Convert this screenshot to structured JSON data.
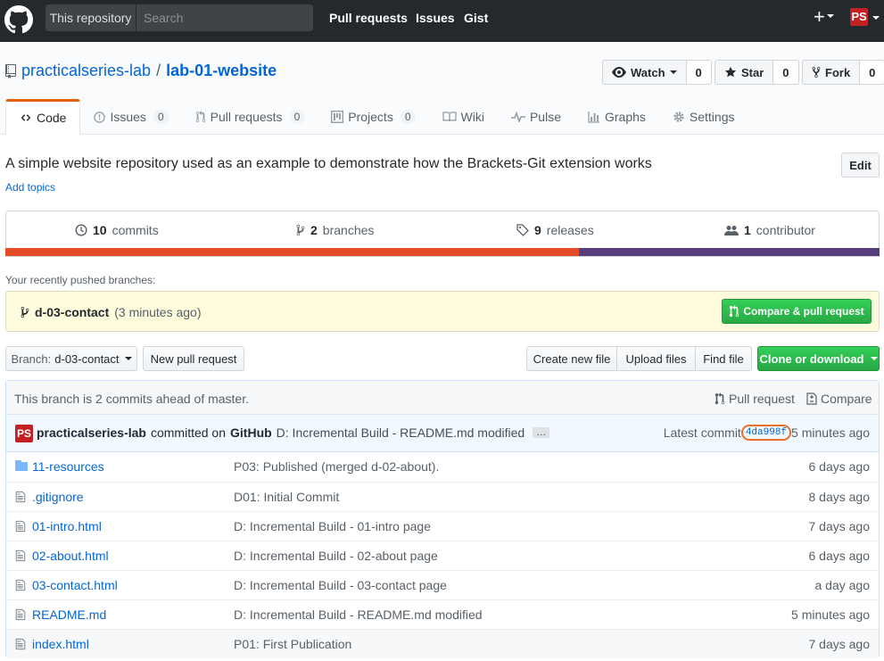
{
  "header": {
    "scope": "This repository",
    "search_placeholder": "Search",
    "nav": [
      "Pull requests",
      "Issues",
      "Gist"
    ],
    "plus": "+",
    "avatar_initials": "PS"
  },
  "repo": {
    "owner": "practicalseries-lab",
    "separator": "/",
    "name": "lab-01-website",
    "watch_label": "Watch",
    "watch_count": "0",
    "star_label": "Star",
    "star_count": "0",
    "fork_label": "Fork",
    "fork_count": "0"
  },
  "tabs": [
    {
      "label": "Code",
      "count": ""
    },
    {
      "label": "Issues",
      "count": "0"
    },
    {
      "label": "Pull requests",
      "count": "0"
    },
    {
      "label": "Projects",
      "count": "0"
    },
    {
      "label": "Wiki",
      "count": ""
    },
    {
      "label": "Pulse",
      "count": ""
    },
    {
      "label": "Graphs",
      "count": ""
    },
    {
      "label": "Settings",
      "count": ""
    }
  ],
  "description": "A simple website repository used as an example to demonstrate how the Brackets-Git extension works",
  "add_topics": "Add topics",
  "edit_label": "Edit",
  "summary": {
    "commits_n": "10",
    "commits_label": "commits",
    "branches_n": "2",
    "branches_label": "branches",
    "releases_n": "9",
    "releases_label": "releases",
    "contrib_n": "1",
    "contrib_label": "contributor"
  },
  "language_colors": [
    "#e34c26",
    "#563d7c"
  ],
  "language_share": [
    0.656,
    0.344
  ],
  "recent": {
    "label": "Your recently pushed branches:",
    "branch": "d-03-contact",
    "time": "(3 minutes ago)",
    "compare_label": "Compare & pull request"
  },
  "filenav": {
    "branch_prefix": "Branch:",
    "branch_name": "d-03-contact",
    "new_pr": "New pull request",
    "create_file": "Create new file",
    "upload": "Upload files",
    "find": "Find file",
    "clone": "Clone or download"
  },
  "ahead": {
    "text": "This branch is 2 commits ahead of master.",
    "pr_label": "Pull request",
    "compare_label": "Compare"
  },
  "tease": {
    "avatar": "PS",
    "author": "practicalseries-lab",
    "committed_on": "committed on",
    "platform": "GitHub",
    "message": "D: Incremental Build - README.md modified",
    "ellipsis": "…",
    "latest": "Latest commit",
    "sha": "4da998f",
    "age": "5 minutes ago"
  },
  "files": [
    {
      "type": "dir",
      "name": "11-resources",
      "message": "P03: Published (merged d-02-about).",
      "age": "6 days ago"
    },
    {
      "type": "file",
      "name": ".gitignore",
      "message": "D01: Initial Commit",
      "age": "8 days ago"
    },
    {
      "type": "file",
      "name": "01-intro.html",
      "message": "D: Incremental Build - 01-intro page",
      "age": "7 days ago"
    },
    {
      "type": "file",
      "name": "02-about.html",
      "message": "D: Incremental Build - 02-about page",
      "age": "6 days ago"
    },
    {
      "type": "file",
      "name": "03-contact.html",
      "message": "D: Incremental Build - 03-contact page",
      "age": "a day ago"
    },
    {
      "type": "file",
      "name": "README.md",
      "message": "D: Incremental Build - README.md modified",
      "age": "5 minutes ago"
    },
    {
      "type": "file",
      "name": "index.html",
      "message": "P01: First Publication",
      "age": "7 days ago"
    }
  ]
}
